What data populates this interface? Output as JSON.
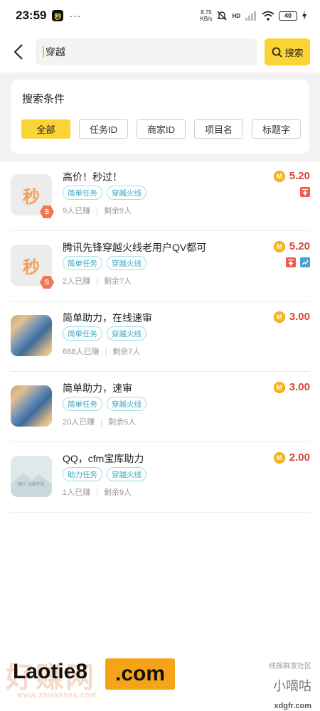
{
  "status_bar": {
    "time": "23:59",
    "app_icon": "秒",
    "dots": "···",
    "speed_top": "8.75",
    "speed_bottom": "KB/s",
    "network": "HD",
    "battery": "40"
  },
  "search": {
    "query": "穿越",
    "button_label": "搜索"
  },
  "conditions": {
    "title": "搜索条件",
    "options": [
      "全部",
      "任务ID",
      "商家ID",
      "项目名",
      "标题字"
    ],
    "selected": "全部"
  },
  "tasks": [
    {
      "title": "高价！秒过！",
      "tags": [
        "简单任务",
        "穿越火线"
      ],
      "earned": "9人已赚",
      "remaining": "剩余9人",
      "price": "5.20",
      "thumb": "秒",
      "badge": "S",
      "icons": [
        "top-icon"
      ]
    },
    {
      "title": "腾讯先锋穿越火线老用户QV都可",
      "tags": [
        "简单任务",
        "穿越火线"
      ],
      "earned": "2人已赚",
      "remaining": "剩余7人",
      "price": "5.20",
      "thumb": "秒",
      "badge": "S",
      "icons": [
        "top-icon",
        "trend-icon"
      ]
    },
    {
      "title": "简单助力，在线速审",
      "tags": [
        "简单任务",
        "穿越火线"
      ],
      "earned": "688人已赚",
      "remaining": "剩余7人",
      "price": "3.00",
      "thumb": "",
      "badge": "",
      "icons": []
    },
    {
      "title": "简单助力，速审",
      "tags": [
        "简单任务",
        "穿越火线"
      ],
      "earned": "20人已赚",
      "remaining": "剩余5人",
      "price": "3.00",
      "thumb": "",
      "badge": "",
      "icons": []
    },
    {
      "title": "QQ，cfm宝库助力",
      "tags": [
        "助力任务",
        "穿越火线"
      ],
      "earned": "1人已赚",
      "remaining": "剩余9人",
      "price": "2.00",
      "thumb": "图片 加载失败",
      "badge": "",
      "icons": []
    }
  ],
  "coin_symbol": "M",
  "watermarks": {
    "left_main": "Laotie8",
    "left_com": ".com",
    "left_faded": "好赚网",
    "left_sub": "www.zhuanses.com",
    "right_top": "线报群发社区",
    "right_mid": "小嘀咕",
    "right_bottom": "xdgfr.com"
  },
  "colors": {
    "accent": "#f9d434",
    "price": "#d9463a",
    "tag": "#35a8c0"
  }
}
